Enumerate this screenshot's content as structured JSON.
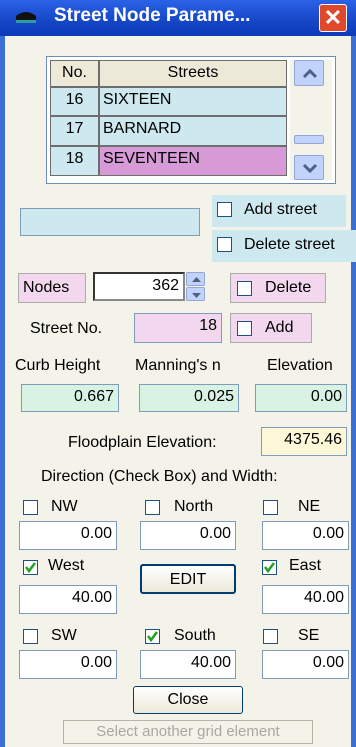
{
  "window": {
    "title": "Street Node Parame...",
    "close_glyph": "✕"
  },
  "streets": {
    "headers": [
      "No.",
      "Streets"
    ],
    "rows": [
      {
        "no": "16",
        "name": "SIXTEEN"
      },
      {
        "no": "17",
        "name": "BARNARD"
      },
      {
        "no": "18",
        "name": "SEVENTEEN"
      }
    ]
  },
  "street_name_value": "",
  "add_street_label": "Add street",
  "delete_street_label": "Delete street",
  "nodes": {
    "label": "Nodes",
    "value": "362",
    "delete_label": "Delete"
  },
  "street_no": {
    "label": "Street No.",
    "value": "18",
    "add_label": "Add"
  },
  "params": {
    "curb_label": "Curb Height",
    "curb_value": "0.667",
    "manning_label": "Manning's n",
    "manning_value": "0.025",
    "elev_label": "Elevation",
    "elev_value": "0.00"
  },
  "floodplain": {
    "label": "Floodplain Elevation:",
    "value": "4375.46"
  },
  "direction_title": "Direction (Check Box) and Width:",
  "directions": {
    "nw": {
      "label": "NW",
      "value": "0.00",
      "checked": false
    },
    "north": {
      "label": "North",
      "value": "0.00",
      "checked": false
    },
    "ne": {
      "label": "NE",
      "value": "0.00",
      "checked": false
    },
    "west": {
      "label": "West",
      "value": "40.00",
      "checked": true
    },
    "east": {
      "label": "East",
      "value": "40.00",
      "checked": true
    },
    "sw": {
      "label": "SW",
      "value": "0.00",
      "checked": false
    },
    "south": {
      "label": "South",
      "value": "40.00",
      "checked": true
    },
    "se": {
      "label": "SE",
      "value": "0.00",
      "checked": false
    }
  },
  "edit_label": "EDIT",
  "close_label": "Close",
  "status_text": "Select another grid element",
  "colors": {
    "title_bar": "#1546c6",
    "cyan": "#cde8ee",
    "pink": "#f2d7ee",
    "magenta": "#d69ad6",
    "green": "#d8f3e4",
    "yellow": "#fff8d8"
  }
}
